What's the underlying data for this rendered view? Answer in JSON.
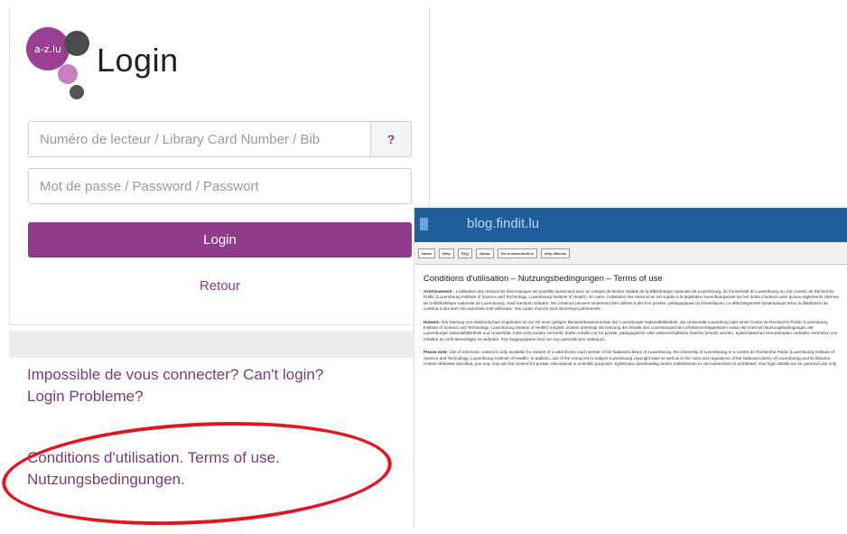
{
  "login": {
    "title": "Login",
    "logo_text": "a-z.lu",
    "username_placeholder": "Numéro de lecteur / Library Card Number / Bib",
    "help_symbol": "?",
    "password_placeholder": "Mot de passe / Password / Passwort",
    "login_button": "Login",
    "back_link": "Retour"
  },
  "help_links": {
    "cant_login_line1": "Impossible de vous connecter? Can't login?",
    "cant_login_line2": "Login Probleme?",
    "terms_line1": "Conditions d'utilisation. Terms of use.",
    "terms_line2": "Nutzungsbedingungen."
  },
  "blog": {
    "site_title": "blog.findit.lu",
    "nav_tabs": [
      "Home",
      "Help",
      "FAQ",
      "About",
      "Go to www.findit.lu",
      "Help eBooks"
    ],
    "page_title": "Conditions d'utilisation – Nutzungsbedingungen – Terms of use",
    "para1_lead": "Avertissement :",
    "para1_text": "L'utilisation des ressources électroniques est possible seulement avec un compte de lecteur valable de la Bibliothèque nationale de Luxembourg, de l'Université du Luxembourg ou d'un Centre de Recherche Public (Luxembourg Institute of Science and Technology, Luxembourg Institute of Health). En outre, l'utilisation des ressources est sujette à la législation luxembourgeoise sur les droits d'auteurs ainsi qu'aux règlements internes de la Bibliothèque nationale de Luxembourg. Sauf mention contraire, les contenus peuvent seulement être utilisés à des fins privées, pédagogiques ou scientifiques. Le téléchargement systématique et/ou la distribution de contenu à des tiers non autorisés sont défendus. Vos codes d'accès sont strictement personnels.",
    "para2_lead": "Hinweis:",
    "para2_text": "Die Nutzung von elektronischen Angeboten ist nur mit einer gültigen Benutzerkartennummer der Luxemburger Nationalbibliothek, der Universität Luxemburg oder eines Centre de Recherche Public (Luxembourg Institute of Science and Technology, Luxembourg Institute of Health) möglich. Zudem unterliegt die Nutzung der Inhalte den Luxemburgischen Urheberrechtsgesetzen sowie den internen Nutzungsbedingungen der Luxemburger Nationalbibliothek und Universität. Falls nicht anders vermerkt, dürfen Inhalte nur für private, pädagogische oder wissenschaftliche Zwecke benutzt werden. Systematisches Herunterladen und/oder Verbreiten von Inhalten an nicht Berechtigte ist verboten. Ihre Zugangsdaten sind nur zum persönlichen Gebrauch.",
    "para3_lead": "Please note:",
    "para3_text": "Use of electronic content is only available for owners of a valid library card number of the National Library of Luxembourg, the University of Luxembourg or a Centre de Recherche Public (Luxembourg Institute of Science and Technology, Luxembourg Institute of Health). In addition, use of the resources is subject Luxembourg copyright laws as well as to the rules and regulations of the National Library of Luxembourg and its libraries. Unless otherwise specified, you may only use the content for private, educational or scientific purposes. Systematic downloading and/or redistribution to non-subscribers is prohibited. Your login details are for personal use only."
  },
  "colors": {
    "brand_purple": "#8e3b8a",
    "link_purple": "#7d3a77",
    "annotation_red": "#e2161c",
    "blog_header_blue": "#1f5e9b"
  }
}
